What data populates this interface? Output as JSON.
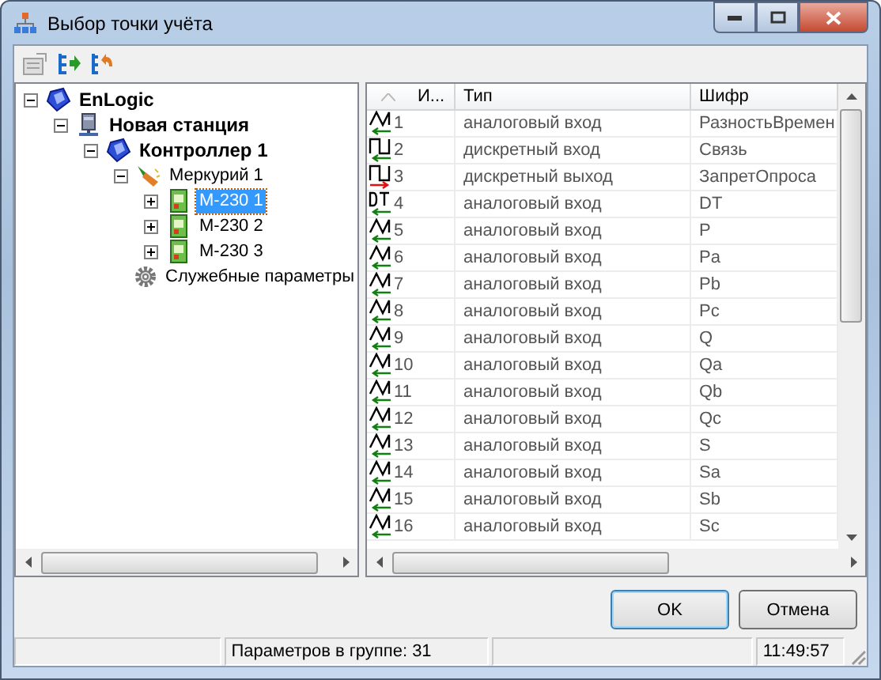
{
  "window": {
    "title": "Выбор точки учёта"
  },
  "toolbar": [
    {
      "kind": "card",
      "disabled": true
    },
    {
      "kind": "expand",
      "disabled": false
    },
    {
      "kind": "undo",
      "disabled": false
    }
  ],
  "tree": [
    {
      "label": "EnLogic",
      "kind": "system",
      "expanded": true,
      "selected": false,
      "children": [
        {
          "label": "Новая станция",
          "kind": "station",
          "expanded": true,
          "selected": false,
          "children": [
            {
              "label": "Контроллер 1",
              "kind": "controller",
              "expanded": true,
              "selected": false,
              "children": [
                {
                  "label": "Меркурий 1",
                  "kind": "meter",
                  "expanded": true,
                  "selected": false,
                  "children": [
                    {
                      "label": "M-230 1",
                      "kind": "device",
                      "expanded": false,
                      "selected": true
                    },
                    {
                      "label": "M-230 2",
                      "kind": "device",
                      "expanded": false,
                      "selected": false
                    },
                    {
                      "label": "M-230 3",
                      "kind": "device",
                      "expanded": false,
                      "selected": false
                    }
                  ]
                },
                {
                  "label": "Служебные параметры",
                  "kind": "service",
                  "selected": false
                }
              ]
            }
          ]
        }
      ]
    }
  ],
  "table": {
    "columns": [
      "И...",
      "Тип",
      "Шифр"
    ],
    "rows": [
      {
        "kind": "analog",
        "output": false,
        "number": "1",
        "type": "аналоговый вход",
        "code": "РазностьВремен"
      },
      {
        "kind": "discrete",
        "output": false,
        "number": "2",
        "type": "дискретный вход",
        "code": "Связь"
      },
      {
        "kind": "discrete",
        "output": true,
        "number": "3",
        "type": "дискретный выход",
        "code": "ЗапретОпроса"
      },
      {
        "kind": "dt",
        "output": false,
        "number": "4",
        "type": "аналоговый вход",
        "code": "DT"
      },
      {
        "kind": "analog",
        "output": false,
        "number": "5",
        "type": "аналоговый вход",
        "code": "P"
      },
      {
        "kind": "analog",
        "output": false,
        "number": "6",
        "type": "аналоговый вход",
        "code": "Pa"
      },
      {
        "kind": "analog",
        "output": false,
        "number": "7",
        "type": "аналоговый вход",
        "code": "Pb"
      },
      {
        "kind": "analog",
        "output": false,
        "number": "8",
        "type": "аналоговый вход",
        "code": "Pc"
      },
      {
        "kind": "analog",
        "output": false,
        "number": "9",
        "type": "аналоговый вход",
        "code": "Q"
      },
      {
        "kind": "analog",
        "output": false,
        "number": "10",
        "type": "аналоговый вход",
        "code": "Qa"
      },
      {
        "kind": "analog",
        "output": false,
        "number": "11",
        "type": "аналоговый вход",
        "code": "Qb"
      },
      {
        "kind": "analog",
        "output": false,
        "number": "12",
        "type": "аналоговый вход",
        "code": "Qc"
      },
      {
        "kind": "analog",
        "output": false,
        "number": "13",
        "type": "аналоговый вход",
        "code": "S"
      },
      {
        "kind": "analog",
        "output": false,
        "number": "14",
        "type": "аналоговый вход",
        "code": "Sa"
      },
      {
        "kind": "analog",
        "output": false,
        "number": "15",
        "type": "аналоговый вход",
        "code": "Sb"
      },
      {
        "kind": "analog",
        "output": false,
        "number": "16",
        "type": "аналоговый вход",
        "code": "Sc"
      }
    ]
  },
  "buttons": [
    "OK",
    "Отмена"
  ],
  "status_bar": {
    "count": "Параметров в группе: 31",
    "time": "11:49:57"
  }
}
